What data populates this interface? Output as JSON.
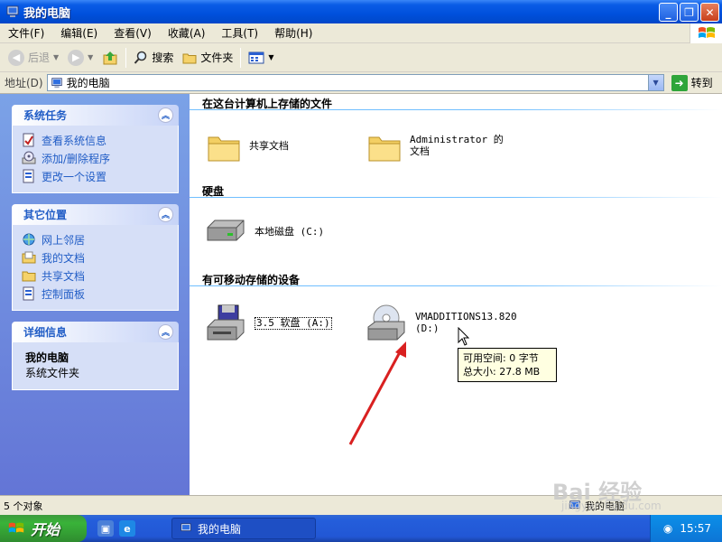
{
  "window": {
    "title": "我的电脑"
  },
  "menubar": {
    "items": [
      "文件(F)",
      "编辑(E)",
      "查看(V)",
      "收藏(A)",
      "工具(T)",
      "帮助(H)"
    ]
  },
  "toolbar": {
    "back": "后退",
    "search": "搜索",
    "folders": "文件夹"
  },
  "address": {
    "label": "地址(D)",
    "value": "我的电脑",
    "go": "转到"
  },
  "sidebar": {
    "system_tasks": {
      "title": "系统任务",
      "items": [
        "查看系统信息",
        "添加/删除程序",
        "更改一个设置"
      ]
    },
    "other_places": {
      "title": "其它位置",
      "items": [
        "网上邻居",
        "我的文档",
        "共享文档",
        "控制面板"
      ]
    },
    "details": {
      "title": "详细信息",
      "name": "我的电脑",
      "type": "系统文件夹"
    }
  },
  "content": {
    "groups": [
      {
        "title": "在这台计算机上存储的文件",
        "items": [
          "共享文档",
          "Administrator 的文档"
        ]
      },
      {
        "title": "硬盘",
        "items": [
          "本地磁盘 (C:)"
        ]
      },
      {
        "title": "有可移动存储的设备",
        "items": [
          "3.5 软盘 (A:)",
          "VMADDITIONS13.820 (D:)"
        ]
      }
    ],
    "tooltip": {
      "line1": "可用空间: 0 字节",
      "line2": "总大小: 27.8 MB"
    }
  },
  "statusbar": {
    "left": "5 个对象",
    "right": "我的电脑"
  },
  "taskbar": {
    "start": "开始",
    "task": "我的电脑",
    "clock": "15:57"
  },
  "watermark": {
    "main": "Bai 经验",
    "url": "jingyan.baidu.com"
  },
  "colors": {
    "titlebar": "#0050dc",
    "sidebar": "#6375d6",
    "link": "#215dc6",
    "taskbar": "#245edb"
  }
}
